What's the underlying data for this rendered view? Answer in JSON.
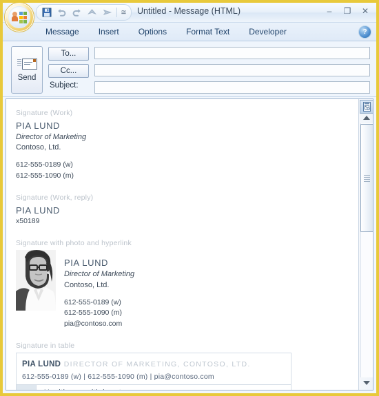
{
  "window": {
    "title": "Untitled  -  Message (HTML)",
    "frame_color": "#e8c93b",
    "minimize_label": "–",
    "maximize_label": "❐",
    "close_label": "✕"
  },
  "orb": {
    "name": "office-button",
    "tooltip": "Office Button"
  },
  "quick_access": {
    "items": [
      {
        "name": "save-icon",
        "label": "Save"
      },
      {
        "name": "undo-icon",
        "label": "Undo"
      },
      {
        "name": "redo-icon",
        "label": "Redo"
      },
      {
        "name": "previous-item-icon",
        "label": "Previous Item"
      },
      {
        "name": "next-item-icon",
        "label": "Next Item"
      }
    ],
    "customize_label": "≅"
  },
  "ribbon": {
    "tabs": [
      {
        "label": "Message"
      },
      {
        "label": "Insert"
      },
      {
        "label": "Options"
      },
      {
        "label": "Format Text"
      },
      {
        "label": "Developer"
      }
    ],
    "help_label": "?"
  },
  "compose": {
    "send_label": "Send",
    "to_label": "To...",
    "cc_label": "Cc...",
    "subject_label": "Subject:",
    "to_value": "",
    "cc_value": "",
    "subject_value": "",
    "to_placeholder": "",
    "cc_placeholder": "",
    "subject_placeholder": ""
  },
  "body": {
    "sections": [
      {
        "label": "Signature (Work)",
        "name": "PIA LUND",
        "title": "Director of Marketing",
        "company": "Contoso, Ltd.",
        "phone_work": "612-555-0189 (w)",
        "phone_mobile": "612-555-1090 (m)"
      },
      {
        "label": "Signature (Work, reply)",
        "name": "PIA LUND",
        "extension": "x50189"
      },
      {
        "label": "Signature with photo and hyperlink",
        "name": "PIA LUND",
        "title": "Director of Marketing",
        "company": "Contoso, Ltd.",
        "phone_work": "612-555-0189 (w)",
        "phone_mobile": "612-555-1090 (m)",
        "email": "pia@contoso.com"
      },
      {
        "label": "Signature in table",
        "name": "PIA LUND",
        "role": "DIRECTOR OF MARKETING, CONTOSO, LTD.",
        "contact": "612-555-0189 (w)  |  612-555-1090 (m)  |  pia@contoso.com",
        "tagline": "Healthcare with heart"
      }
    ]
  },
  "scrollbar": {
    "top_icon_name": "select-browse-object-icon",
    "up_label": "▲",
    "down_label": "▼"
  }
}
